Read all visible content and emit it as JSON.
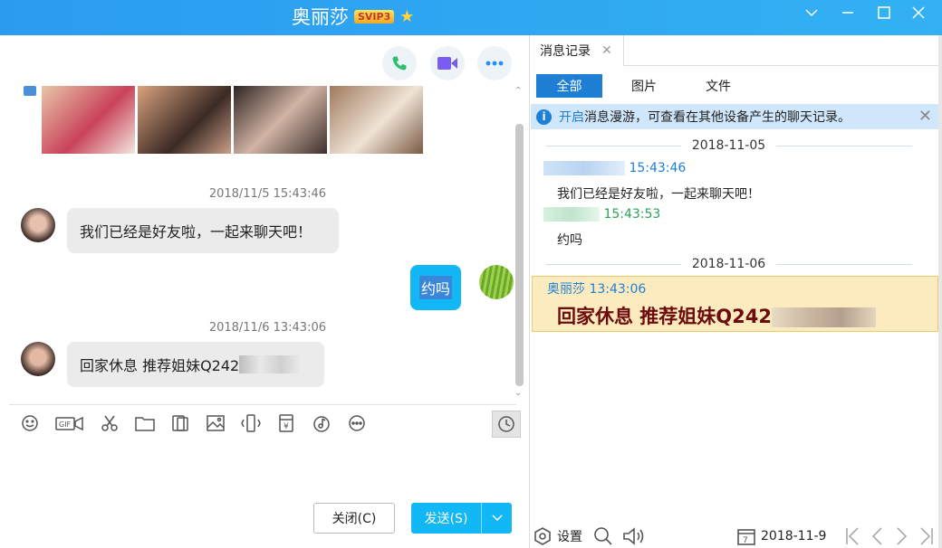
{
  "titlebar": {
    "name": "奥丽莎",
    "vip_badge": "SVIP3",
    "star_icon": "star-icon"
  },
  "chat": {
    "messages": [
      {
        "timestamp": "2018/11/5 15:43:46",
        "text": "我们已经是好友啦，一起来聊天吧！",
        "side": "left"
      },
      {
        "text": "约吗",
        "side": "right"
      },
      {
        "timestamp": "2018/11/6 13:43:06",
        "text": "回家休息 推荐姐妹Q242",
        "side": "left"
      }
    ],
    "close_button": "关闭(C)",
    "send_button": "发送(S)"
  },
  "history": {
    "tab_label": "消息记录",
    "filters": [
      "全部",
      "图片",
      "文件"
    ],
    "notice_link": "开启",
    "notice_text": "消息漫游，可查看在其他设备产生的聊天记录。",
    "dates": [
      "2018-11-05",
      "2018-11-06"
    ],
    "records": [
      {
        "time": "15:43:46",
        "text": "我们已经是好友啦，一起来聊天吧！",
        "color": "#1e7fd4"
      },
      {
        "time": "15:43:53",
        "text": "约吗",
        "color": "#2aa35a"
      }
    ],
    "highlight": {
      "head": "奥丽莎 13:43:06",
      "text": "回家休息  推荐姐妹Q242"
    },
    "settings_label": "设置",
    "calendar_day": "7",
    "current_date": "2018-11-9"
  },
  "colors": {
    "accent": "#12b7f5",
    "titlebar": "#2b9bf0",
    "tab_active": "#1e7fd4",
    "highlight_bg": "#fdebc0"
  }
}
